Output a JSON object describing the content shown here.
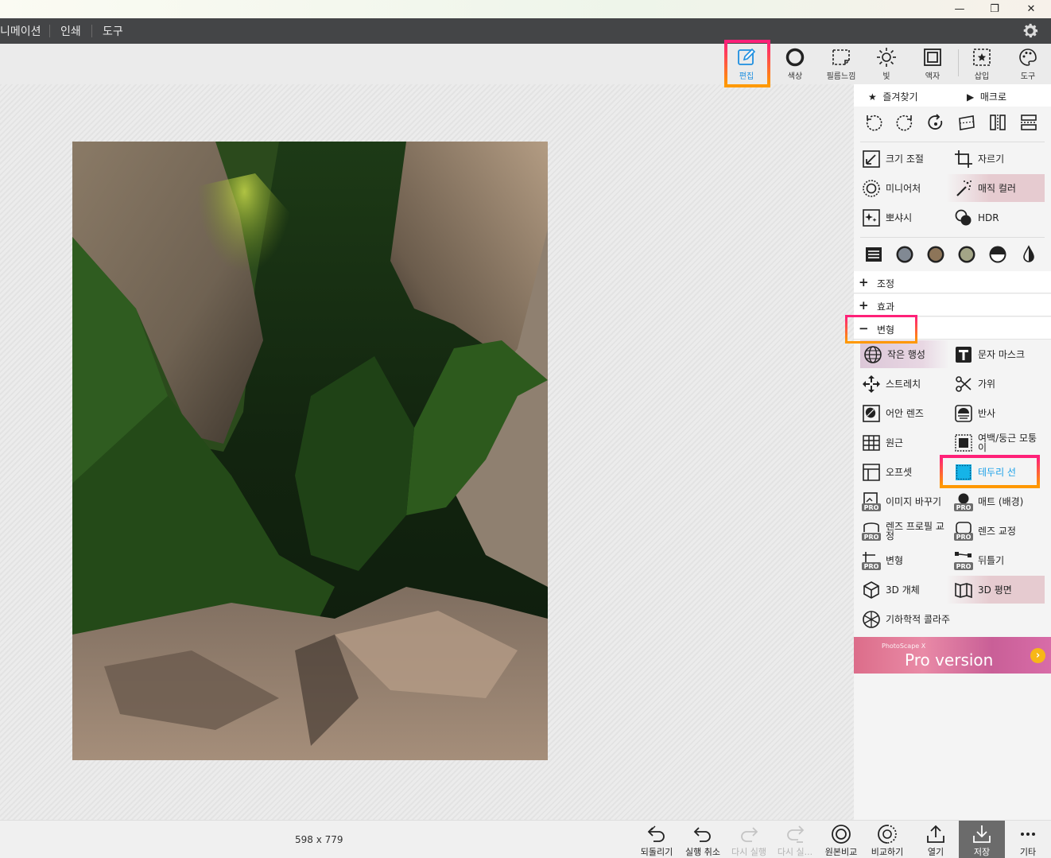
{
  "window": {
    "minimize": "—",
    "maximize": "❐",
    "close": "✕"
  },
  "menu": {
    "items": [
      "니메이션",
      "인쇄",
      "도구"
    ]
  },
  "toolbar": {
    "tools": [
      {
        "label": "편집",
        "icon": "edit-icon"
      },
      {
        "label": "색상",
        "icon": "color-icon"
      },
      {
        "label": "필름느낌",
        "icon": "film-icon"
      },
      {
        "label": "빛",
        "icon": "light-icon"
      },
      {
        "label": "액자",
        "icon": "frame-icon"
      },
      {
        "label": "삽입",
        "icon": "insert-icon"
      },
      {
        "label": "도구",
        "icon": "tools-icon"
      }
    ]
  },
  "image": {
    "dimensions": "598 x 779"
  },
  "bottom": {
    "buttons": [
      {
        "label": "되돌리기",
        "icon": "revert-icon",
        "enabled": true
      },
      {
        "label": "실행 취소",
        "icon": "undo-icon",
        "enabled": true
      },
      {
        "label": "다시 실행",
        "icon": "redo-icon",
        "enabled": false
      },
      {
        "label": "다시 실...",
        "icon": "redo-all-icon",
        "enabled": false
      },
      {
        "label": "원본비교",
        "icon": "compare-original-icon",
        "enabled": true
      },
      {
        "label": "비교하기",
        "icon": "compare-icon",
        "enabled": true
      },
      {
        "label": "열기",
        "icon": "open-icon",
        "enabled": true
      },
      {
        "label": "저장",
        "icon": "save-icon",
        "enabled": true
      },
      {
        "label": "기타",
        "icon": "more-icon",
        "enabled": true
      }
    ]
  },
  "panel": {
    "favorites": "즐겨찾기",
    "macro": "매크로",
    "functions": {
      "resize": "크기 조절",
      "crop": "자르기",
      "miniature": "미니어처",
      "magic_color": "매직 컬러",
      "sparkle": "뽀샤시",
      "hdr": "HDR"
    },
    "sections": {
      "adjust": "조정",
      "effects": "효과",
      "transform": "변형"
    },
    "transform_items": {
      "tiny_planet": "작은 행성",
      "text_mask": "문자 마스크",
      "stretch": "스트레치",
      "scissors": "가위",
      "fisheye": "어안 렌즈",
      "reflection": "반사",
      "perspective": "원근",
      "margin_rounded": "여백/둥근 모퉁이",
      "offset": "오프셋",
      "border_line": "테두리 선",
      "replace_image": "이미지 바꾸기",
      "matte": "매트 (배경)",
      "lens_profile": "렌즈 프로필 교정",
      "lens_correction": "렌즈 교정",
      "transform": "변형",
      "warp": "뒤틀기",
      "object_3d": "3D 개체",
      "plane_3d": "3D 평면",
      "geometric_collage": "기하학적 콜라주"
    },
    "promo": {
      "small": "PhotoScape X",
      "big": "Pro version"
    }
  },
  "colors": {
    "highlight_pink": "#ff1f7a",
    "highlight_orange": "#ff9a00",
    "accent_blue": "#1e8fe0"
  }
}
